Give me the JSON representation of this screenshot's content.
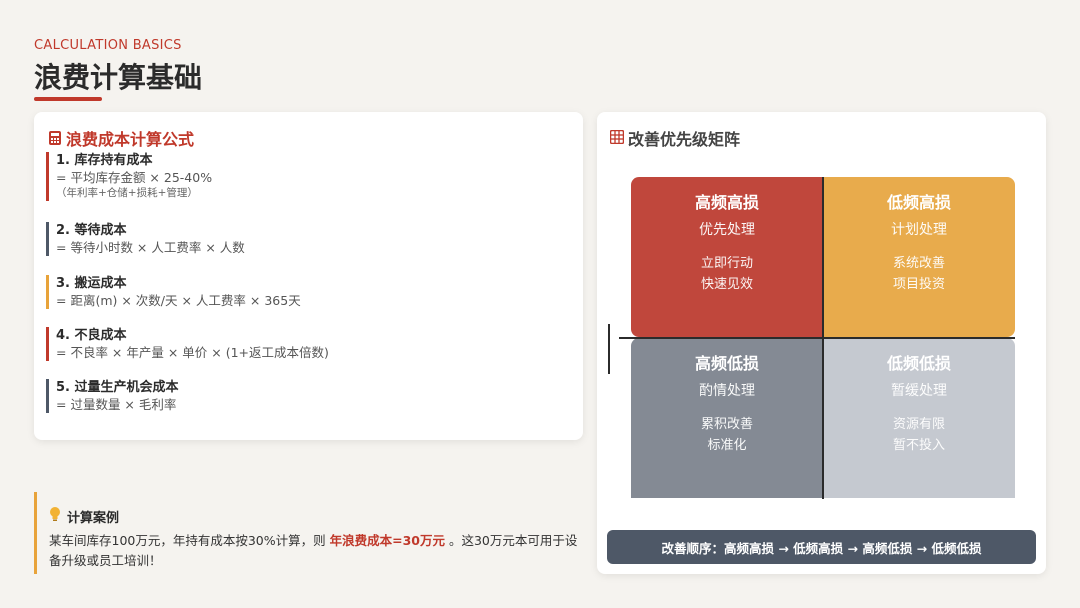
{
  "header": {
    "eyebrow": "CALCULATION BASICS",
    "title": "浪费计算基础"
  },
  "formula_card": {
    "icon": "calculator-icon",
    "heading": "浪费成本计算公式",
    "items": [
      {
        "title": "1. 库存持有成本",
        "formula": "= 平均库存金额 × 25-40%",
        "note": "（年利率+仓储+损耗+管理）",
        "color": "#c0392b"
      },
      {
        "title": "2. 等待成本",
        "formula": "= 等待小时数 × 人工费率 × 人数",
        "note": "",
        "color": "#4e5867"
      },
      {
        "title": "3. 搬运成本",
        "formula": "= 距离(m) × 次数/天 × 人工费率 × 365天",
        "note": "",
        "color": "#e8a33a"
      },
      {
        "title": "4. 不良成本",
        "formula": "= 不良率 × 年产量 × 单价 × (1+返工成本倍数)",
        "note": "",
        "color": "#c0392b"
      },
      {
        "title": "5. 过量生产机会成本",
        "formula": "= 过量数量 × 毛利率",
        "note": "",
        "color": "#4e5867"
      }
    ]
  },
  "case": {
    "icon": "lightbulb-icon",
    "heading": "计算案例",
    "text_before": "某车间库存100万元，年持有成本按30%计算，则 ",
    "highlight": "年浪费成本=30万元",
    "text_after": " 。这30万元本可用于设备升级或员工培训！"
  },
  "matrix": {
    "icon": "grid-icon",
    "heading": "改善优先级矩阵",
    "quadrants": {
      "top_left": {
        "title": "高频高损",
        "sub": "优先处理",
        "act1": "立即行动",
        "act2": "快速见效",
        "color": "#c0473c"
      },
      "top_right": {
        "title": "低频高损",
        "sub": "计划处理",
        "act1": "系统改善",
        "act2": "项目投资",
        "color": "#e8ab4c"
      },
      "bottom_left": {
        "title": "高频低损",
        "sub": "酌情处理",
        "act1": "累积改善",
        "act2": "标准化",
        "color": "#848a94"
      },
      "bottom_right": {
        "title": "低频低损",
        "sub": "暂缓处理",
        "act1": "资源有限",
        "act2": "暂不投入",
        "color": "#c5c9d0"
      }
    },
    "order": "改善顺序：高频高损 → 低频高损 → 高频低损 → 低频低损"
  }
}
